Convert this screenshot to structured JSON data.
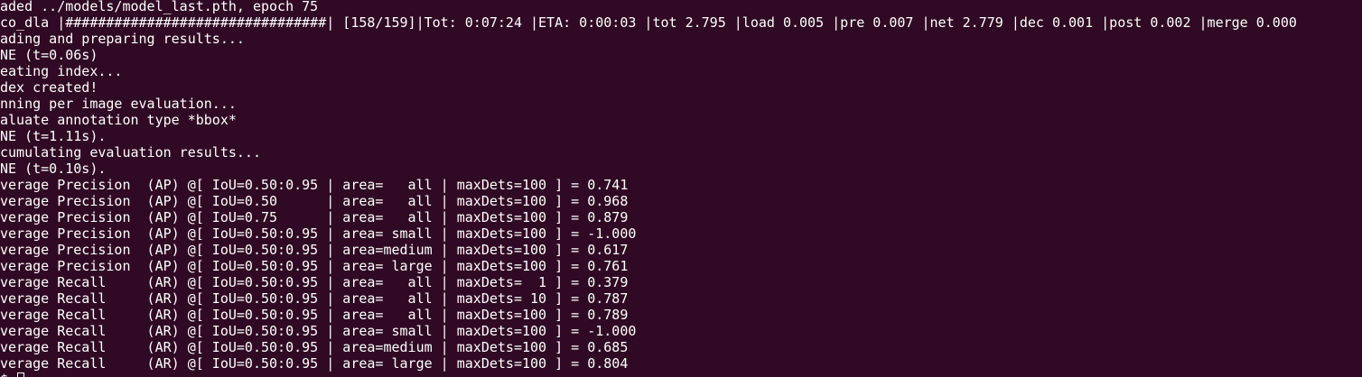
{
  "terminal": {
    "lines": [
      "aded ../models/model_last.pth, epoch 75",
      "co_dla |################################| [158/159]|Tot: 0:07:24 |ETA: 0:00:03 |tot 2.795 |load 0.005 |pre 0.007 |net 2.779 |dec 0.001 |post 0.002 |merge 0.000",
      "ading and preparing results...",
      "NE (t=0.06s)",
      "eating index...",
      "dex created!",
      "nning per image evaluation...",
      "aluate annotation type *bbox*",
      "NE (t=1.11s).",
      "cumulating evaluation results...",
      "NE (t=0.10s).",
      "verage Precision  (AP) @[ IoU=0.50:0.95 | area=   all | maxDets=100 ] = 0.741",
      "verage Precision  (AP) @[ IoU=0.50      | area=   all | maxDets=100 ] = 0.968",
      "verage Precision  (AP) @[ IoU=0.75      | area=   all | maxDets=100 ] = 0.879",
      "verage Precision  (AP) @[ IoU=0.50:0.95 | area= small | maxDets=100 ] = -1.000",
      "verage Precision  (AP) @[ IoU=0.50:0.95 | area=medium | maxDets=100 ] = 0.617",
      "verage Precision  (AP) @[ IoU=0.50:0.95 | area= large | maxDets=100 ] = 0.761",
      "verage Recall     (AR) @[ IoU=0.50:0.95 | area=   all | maxDets=  1 ] = 0.379",
      "verage Recall     (AR) @[ IoU=0.50:0.95 | area=   all | maxDets= 10 ] = 0.787",
      "verage Recall     (AR) @[ IoU=0.50:0.95 | area=   all | maxDets=100 ] = 0.789",
      "verage Recall     (AR) @[ IoU=0.50:0.95 | area= small | maxDets=100 ] = -1.000",
      "verage Recall     (AR) @[ IoU=0.50:0.95 | area=medium | maxDets=100 ] = 0.685",
      "verage Recall     (AR) @[ IoU=0.50:0.95 | area= large | maxDets=100 ] = 0.804"
    ],
    "prompt": {
      "user": "",
      "separator": "",
      "path": "",
      "symbol": "$ "
    },
    "colors": {
      "background": "#300a24",
      "text": "#ffffff",
      "prompt_user": "#8ae234",
      "prompt_path": "#729fcf"
    }
  }
}
